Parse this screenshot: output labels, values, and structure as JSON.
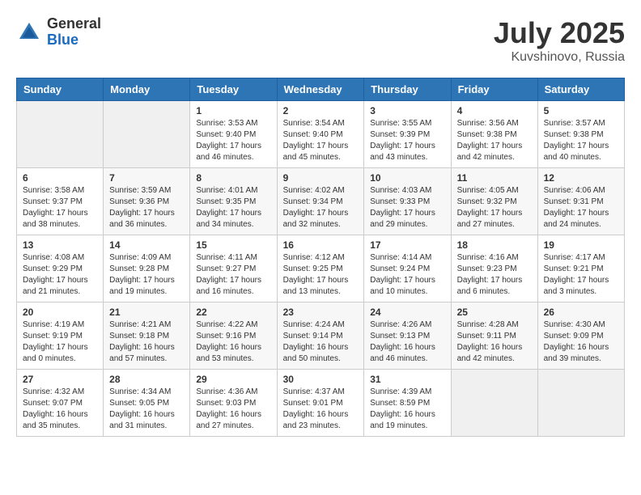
{
  "header": {
    "logo_general": "General",
    "logo_blue": "Blue",
    "month_year": "July 2025",
    "location": "Kuvshinovo, Russia"
  },
  "days_of_week": [
    "Sunday",
    "Monday",
    "Tuesday",
    "Wednesday",
    "Thursday",
    "Friday",
    "Saturday"
  ],
  "weeks": [
    [
      null,
      null,
      {
        "day": "1",
        "sunrise": "Sunrise: 3:53 AM",
        "sunset": "Sunset: 9:40 PM",
        "daylight": "Daylight: 17 hours and 46 minutes."
      },
      {
        "day": "2",
        "sunrise": "Sunrise: 3:54 AM",
        "sunset": "Sunset: 9:40 PM",
        "daylight": "Daylight: 17 hours and 45 minutes."
      },
      {
        "day": "3",
        "sunrise": "Sunrise: 3:55 AM",
        "sunset": "Sunset: 9:39 PM",
        "daylight": "Daylight: 17 hours and 43 minutes."
      },
      {
        "day": "4",
        "sunrise": "Sunrise: 3:56 AM",
        "sunset": "Sunset: 9:38 PM",
        "daylight": "Daylight: 17 hours and 42 minutes."
      },
      {
        "day": "5",
        "sunrise": "Sunrise: 3:57 AM",
        "sunset": "Sunset: 9:38 PM",
        "daylight": "Daylight: 17 hours and 40 minutes."
      }
    ],
    [
      {
        "day": "6",
        "sunrise": "Sunrise: 3:58 AM",
        "sunset": "Sunset: 9:37 PM",
        "daylight": "Daylight: 17 hours and 38 minutes."
      },
      {
        "day": "7",
        "sunrise": "Sunrise: 3:59 AM",
        "sunset": "Sunset: 9:36 PM",
        "daylight": "Daylight: 17 hours and 36 minutes."
      },
      {
        "day": "8",
        "sunrise": "Sunrise: 4:01 AM",
        "sunset": "Sunset: 9:35 PM",
        "daylight": "Daylight: 17 hours and 34 minutes."
      },
      {
        "day": "9",
        "sunrise": "Sunrise: 4:02 AM",
        "sunset": "Sunset: 9:34 PM",
        "daylight": "Daylight: 17 hours and 32 minutes."
      },
      {
        "day": "10",
        "sunrise": "Sunrise: 4:03 AM",
        "sunset": "Sunset: 9:33 PM",
        "daylight": "Daylight: 17 hours and 29 minutes."
      },
      {
        "day": "11",
        "sunrise": "Sunrise: 4:05 AM",
        "sunset": "Sunset: 9:32 PM",
        "daylight": "Daylight: 17 hours and 27 minutes."
      },
      {
        "day": "12",
        "sunrise": "Sunrise: 4:06 AM",
        "sunset": "Sunset: 9:31 PM",
        "daylight": "Daylight: 17 hours and 24 minutes."
      }
    ],
    [
      {
        "day": "13",
        "sunrise": "Sunrise: 4:08 AM",
        "sunset": "Sunset: 9:29 PM",
        "daylight": "Daylight: 17 hours and 21 minutes."
      },
      {
        "day": "14",
        "sunrise": "Sunrise: 4:09 AM",
        "sunset": "Sunset: 9:28 PM",
        "daylight": "Daylight: 17 hours and 19 minutes."
      },
      {
        "day": "15",
        "sunrise": "Sunrise: 4:11 AM",
        "sunset": "Sunset: 9:27 PM",
        "daylight": "Daylight: 17 hours and 16 minutes."
      },
      {
        "day": "16",
        "sunrise": "Sunrise: 4:12 AM",
        "sunset": "Sunset: 9:25 PM",
        "daylight": "Daylight: 17 hours and 13 minutes."
      },
      {
        "day": "17",
        "sunrise": "Sunrise: 4:14 AM",
        "sunset": "Sunset: 9:24 PM",
        "daylight": "Daylight: 17 hours and 10 minutes."
      },
      {
        "day": "18",
        "sunrise": "Sunrise: 4:16 AM",
        "sunset": "Sunset: 9:23 PM",
        "daylight": "Daylight: 17 hours and 6 minutes."
      },
      {
        "day": "19",
        "sunrise": "Sunrise: 4:17 AM",
        "sunset": "Sunset: 9:21 PM",
        "daylight": "Daylight: 17 hours and 3 minutes."
      }
    ],
    [
      {
        "day": "20",
        "sunrise": "Sunrise: 4:19 AM",
        "sunset": "Sunset: 9:19 PM",
        "daylight": "Daylight: 17 hours and 0 minutes."
      },
      {
        "day": "21",
        "sunrise": "Sunrise: 4:21 AM",
        "sunset": "Sunset: 9:18 PM",
        "daylight": "Daylight: 16 hours and 57 minutes."
      },
      {
        "day": "22",
        "sunrise": "Sunrise: 4:22 AM",
        "sunset": "Sunset: 9:16 PM",
        "daylight": "Daylight: 16 hours and 53 minutes."
      },
      {
        "day": "23",
        "sunrise": "Sunrise: 4:24 AM",
        "sunset": "Sunset: 9:14 PM",
        "daylight": "Daylight: 16 hours and 50 minutes."
      },
      {
        "day": "24",
        "sunrise": "Sunrise: 4:26 AM",
        "sunset": "Sunset: 9:13 PM",
        "daylight": "Daylight: 16 hours and 46 minutes."
      },
      {
        "day": "25",
        "sunrise": "Sunrise: 4:28 AM",
        "sunset": "Sunset: 9:11 PM",
        "daylight": "Daylight: 16 hours and 42 minutes."
      },
      {
        "day": "26",
        "sunrise": "Sunrise: 4:30 AM",
        "sunset": "Sunset: 9:09 PM",
        "daylight": "Daylight: 16 hours and 39 minutes."
      }
    ],
    [
      {
        "day": "27",
        "sunrise": "Sunrise: 4:32 AM",
        "sunset": "Sunset: 9:07 PM",
        "daylight": "Daylight: 16 hours and 35 minutes."
      },
      {
        "day": "28",
        "sunrise": "Sunrise: 4:34 AM",
        "sunset": "Sunset: 9:05 PM",
        "daylight": "Daylight: 16 hours and 31 minutes."
      },
      {
        "day": "29",
        "sunrise": "Sunrise: 4:36 AM",
        "sunset": "Sunset: 9:03 PM",
        "daylight": "Daylight: 16 hours and 27 minutes."
      },
      {
        "day": "30",
        "sunrise": "Sunrise: 4:37 AM",
        "sunset": "Sunset: 9:01 PM",
        "daylight": "Daylight: 16 hours and 23 minutes."
      },
      {
        "day": "31",
        "sunrise": "Sunrise: 4:39 AM",
        "sunset": "Sunset: 8:59 PM",
        "daylight": "Daylight: 16 hours and 19 minutes."
      },
      null,
      null
    ]
  ]
}
